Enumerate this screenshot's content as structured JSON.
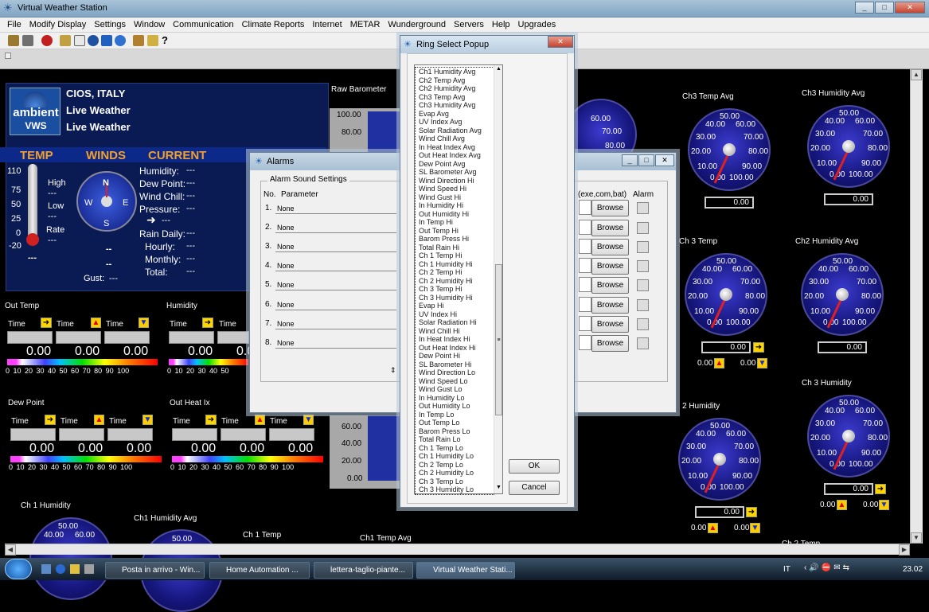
{
  "window": {
    "title": "Virtual Weather Station",
    "controls": [
      "_",
      "□",
      "✕"
    ]
  },
  "menu": [
    "File",
    "Modify Display",
    "Settings",
    "Window",
    "Communication",
    "Climate Reports",
    "Internet",
    "METAR",
    "Wunderground",
    "Servers",
    "Help",
    "Upgrades"
  ],
  "station": {
    "name": "CIOS, ITALY",
    "line2": "Live Weather",
    "line3": "Live Weather",
    "logo_top": "ambient",
    "logo_bottom": "VWS"
  },
  "headers": {
    "temp": "TEMP",
    "winds": "WINDS",
    "current": "CURRENT"
  },
  "temp_scale": [
    "110",
    "75",
    "50",
    "25",
    "0",
    "-20"
  ],
  "temp_side": {
    "high": "High",
    "low": "Low",
    "rate": "Rate",
    "dash": "---"
  },
  "compass": {
    "n": "N",
    "s": "S",
    "e": "E",
    "w": "W",
    "gust_label": "Gust:",
    "dash": "--",
    "gust_value": "---"
  },
  "current": [
    {
      "label": "Humidity:",
      "value": "---"
    },
    {
      "label": "Dew Point:",
      "value": "---"
    },
    {
      "label": "Wind Chill:",
      "value": "---"
    },
    {
      "label": "Pressure:",
      "value": "---"
    }
  ],
  "rain": [
    {
      "label": "Rain Daily:",
      "value": "---"
    },
    {
      "label": "Hourly:",
      "value": "---"
    },
    {
      "label": "Monthly:",
      "value": "---"
    },
    {
      "label": "Total:",
      "value": "---"
    }
  ],
  "raw_barometer": {
    "title": "Raw Barometer",
    "ticks_top": [
      "100.00",
      "80.00"
    ],
    "ticks_bottom": [
      "60.00",
      "40.00",
      "20.00",
      "0.00"
    ]
  },
  "mini_panels": [
    {
      "title": "Out Temp",
      "time": "Time",
      "values": [
        "0.00",
        "0.00",
        "0.00"
      ],
      "scale": "0  10  20  30  40  50  60  70  80  90  100"
    },
    {
      "title": "Humidity",
      "time": "Time",
      "values": [
        "0.00",
        "0.0"
      ],
      "scale": "0  10  20  30  40  50"
    },
    {
      "title": "Dew Point",
      "time": "Time",
      "values": [
        "0.00",
        "0.00",
        "0.00"
      ],
      "scale": "0  10  20  30  40  50  60  70  80  90  100"
    },
    {
      "title": "Out Heat Ix",
      "time": "Time",
      "values": [
        "0.00",
        "0.00",
        "0.00"
      ],
      "scale": "0  10  20  30  40  50  60  70  80  90  100"
    }
  ],
  "gauges": [
    {
      "title": "Ch3 Temp Avg",
      "value": "0.00"
    },
    {
      "title": "Ch3 Humidity Avg",
      "value": "0.00"
    },
    {
      "title": "Ch 3 Temp",
      "value": "0.00"
    },
    {
      "title": "Ch2 Humidity Avg",
      "value": "0.00"
    },
    {
      "title": "Ch 3 Humidity",
      "value": "0.00"
    },
    {
      "title": "2 Humidity",
      "value": "0.00"
    }
  ],
  "gauge_labels": [
    "50.00",
    "40.00",
    "60.00",
    "30.00",
    "70.00",
    "20.00",
    "80.00",
    "10.00",
    "90.00",
    "0.00",
    "100.00"
  ],
  "small_values": {
    "up": "0.00",
    "down": "0.00"
  },
  "bottom_titles": {
    "ch1_humidity": "Ch 1 Humidity",
    "ch1_humidity_avg": "Ch1 Humidity Avg",
    "ch1_temp": "Ch 1 Temp",
    "ch1_temp_avg": "Ch1 Temp Avg",
    "ch2_temp": "Ch 2 Temp"
  },
  "bottom_gauge_labels": {
    "a": "50.00",
    "b": "40.00",
    "c": "60.00",
    "d": "50.00"
  },
  "alarms": {
    "title": "Alarms",
    "group": "Alarm Sound Settings",
    "col_no": "No.",
    "col_param": "Parameter",
    "col_exe": "(exe,com,bat)",
    "col_alarm": "Alarm",
    "rows": [
      {
        "no": "1.",
        "param": "None"
      },
      {
        "no": "2.",
        "param": "None"
      },
      {
        "no": "3.",
        "param": "None"
      },
      {
        "no": "4.",
        "param": "None"
      },
      {
        "no": "5.",
        "param": "None"
      },
      {
        "no": "6.",
        "param": "None"
      },
      {
        "no": "7.",
        "param": "None"
      },
      {
        "no": "8.",
        "param": "None"
      }
    ],
    "browse": "Browse"
  },
  "ring": {
    "title": "Ring Select Popup",
    "items": [
      "Ch1 Humidity Avg",
      "Ch2 Temp Avg",
      "Ch2 Humidity Avg",
      "Ch3 Temp Avg",
      "Ch3 Humidity Avg",
      "Evap Avg",
      "UV Index Avg",
      "Solar Radiation Avg",
      "Wind Chill Avg",
      "In Heat Index Avg",
      "Out Heat Index Avg",
      "Dew Point Avg",
      "SL Barometer Avg",
      "Wind Direction Hi",
      "Wind Speed Hi",
      "Wind Gust Hi",
      "In Humidity Hi",
      "Out Humidity Hi",
      "In Temp Hi",
      "Out Temp Hi",
      "Barom Press Hi",
      "Total Rain Hi",
      "Ch 1 Temp Hi",
      "Ch 1 Humidity Hi",
      "Ch 2 Temp Hi",
      "Ch 2 Humidity Hi",
      "Ch 3 Temp Hi",
      "Ch 3 Humidity Hi",
      "Evap Hi",
      "UV Index Hi",
      "Solar Radiation Hi",
      "Wind Chill Hi",
      "In Heat Index Hi",
      "Out Heat Index Hi",
      "Dew Point Hi",
      "SL Barometer Hi",
      "Wind Direction Lo",
      "Wind Speed Lo",
      "Wind Gust Lo",
      "In Humidity Lo",
      "Out Humidity Lo",
      "In Temp Lo",
      "Out Temp Lo",
      "Barom Press Lo",
      "Total Rain Lo",
      "Ch 1 Temp Lo",
      "Ch 1 Humidity Lo",
      "Ch 2 Temp Lo",
      "Ch 2 Humidity Lo",
      "Ch 3 Temp Lo",
      "Ch 3 Humidity Lo"
    ],
    "ok": "OK",
    "cancel": "Cancel"
  },
  "taskbar": {
    "tasks": [
      "Posta in arrivo - Win...",
      "Home Automation ...",
      "lettera-taglio-piante...",
      "Virtual Weather Stati..."
    ],
    "lang": "IT",
    "clock": "23.02"
  }
}
